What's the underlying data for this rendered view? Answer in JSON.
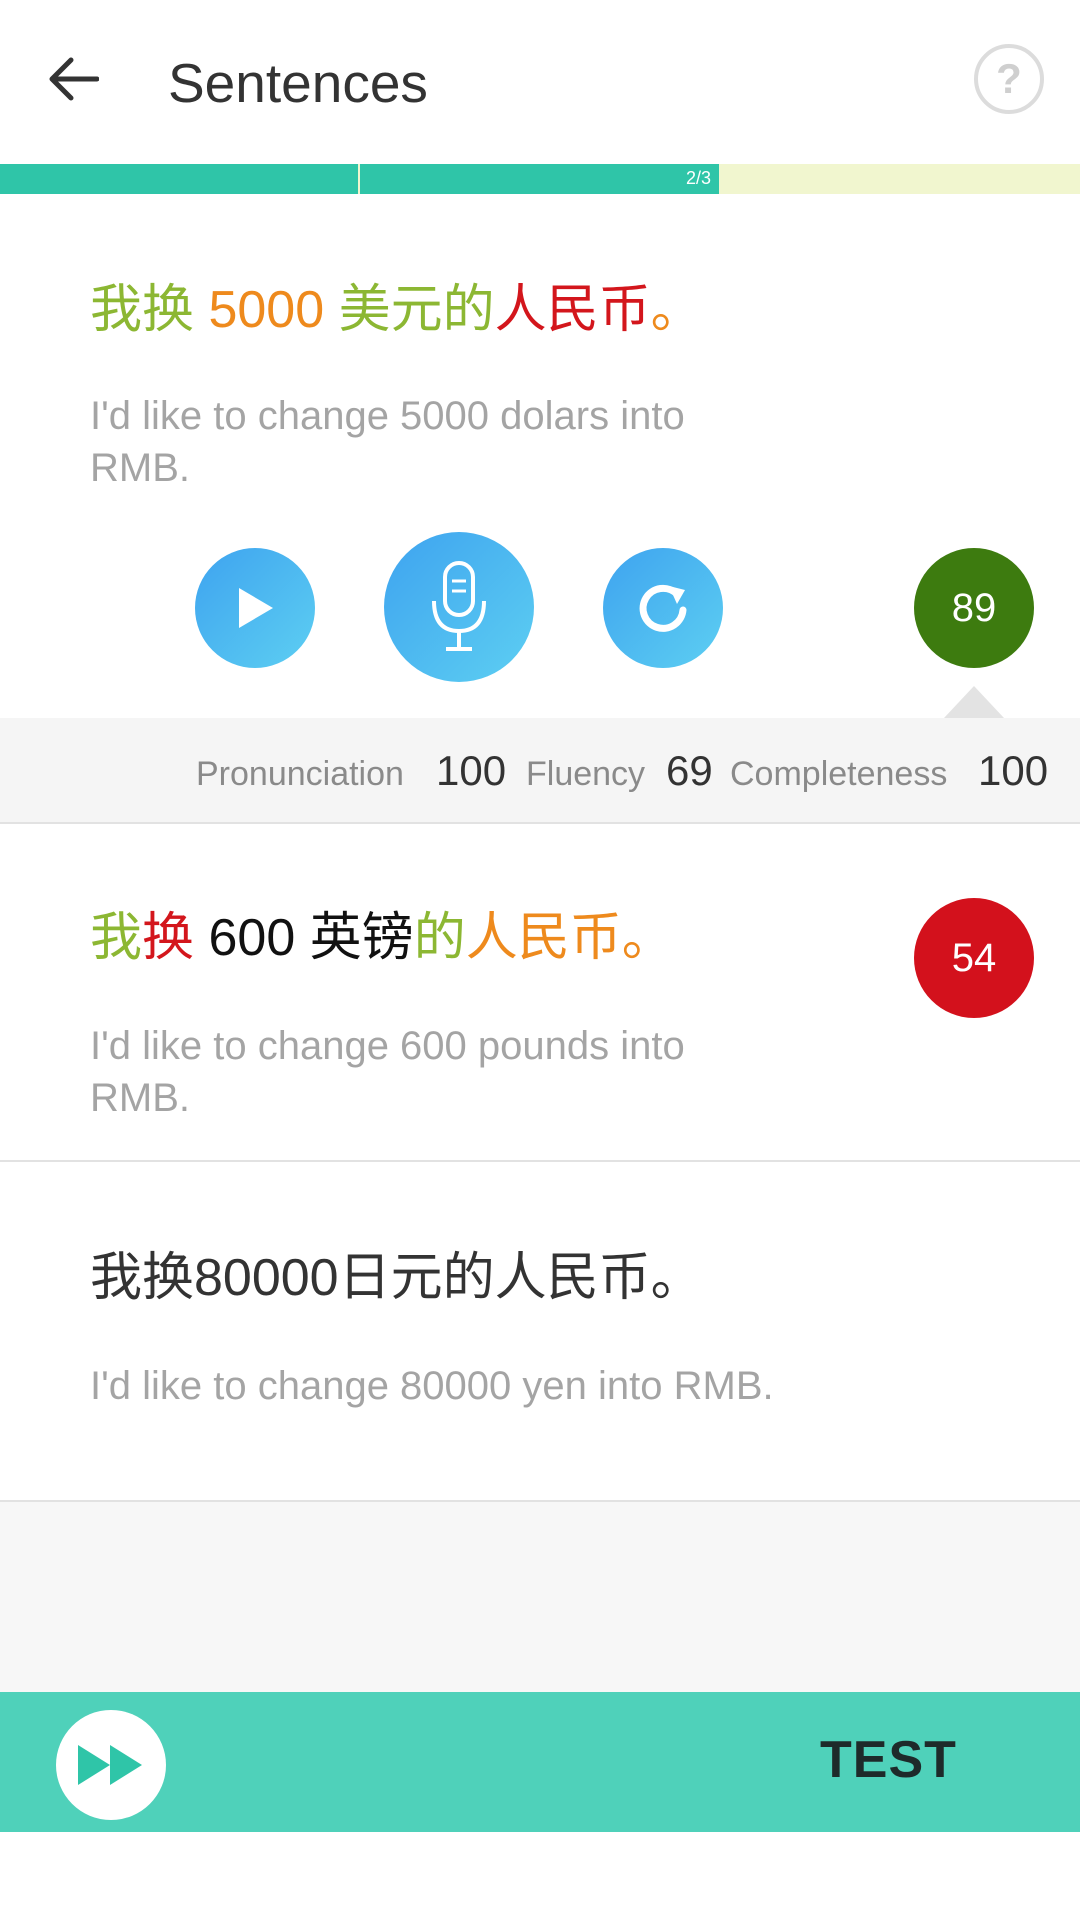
{
  "header": {
    "title": "Sentences",
    "help_label": "?"
  },
  "progress": {
    "label": "2/3",
    "fraction": 0.666
  },
  "sentences": [
    {
      "chinese_segments": [
        {
          "text": "我换 ",
          "color": "#8cb733"
        },
        {
          "text": "5000 ",
          "color": "#ee8a1d"
        },
        {
          "text": "美元的",
          "color": "#8cb733"
        },
        {
          "text": "人民币",
          "color": "#d3161c"
        },
        {
          "text": "。",
          "color": "#ee8a1d"
        }
      ],
      "english": "I'd like to change 5000 dolars into RMB.",
      "score": "89",
      "score_color": "#3d7b0f",
      "metrics": {
        "pronunciation_label": "Pronunciation",
        "pronunciation_value": "100",
        "fluency_label": "Fluency",
        "fluency_value": "69",
        "completeness_label": "Completeness",
        "completeness_value": "100"
      }
    },
    {
      "chinese_segments": [
        {
          "text": "我",
          "color": "#8cb733"
        },
        {
          "text": "换",
          "color": "#d3161c"
        },
        {
          "text": " 600 英镑",
          "color": "#111111"
        },
        {
          "text": "的",
          "color": "#8cb733"
        },
        {
          "text": "人民币。",
          "color": "#ee8a1d"
        }
      ],
      "english": "I'd like to change 600 pounds into RMB.",
      "score": "54",
      "score_color": "#d3111c"
    },
    {
      "chinese": "我换80000日元的人民币。",
      "english": "I'd like to change 80000 yen into RMB."
    }
  ],
  "controls": {
    "play_icon": "play-icon",
    "mic_icon": "microphone-icon",
    "replay_icon": "replay-icon"
  },
  "bottom_bar": {
    "skip_icon": "fast-forward-icon",
    "test_label": "TEST"
  }
}
